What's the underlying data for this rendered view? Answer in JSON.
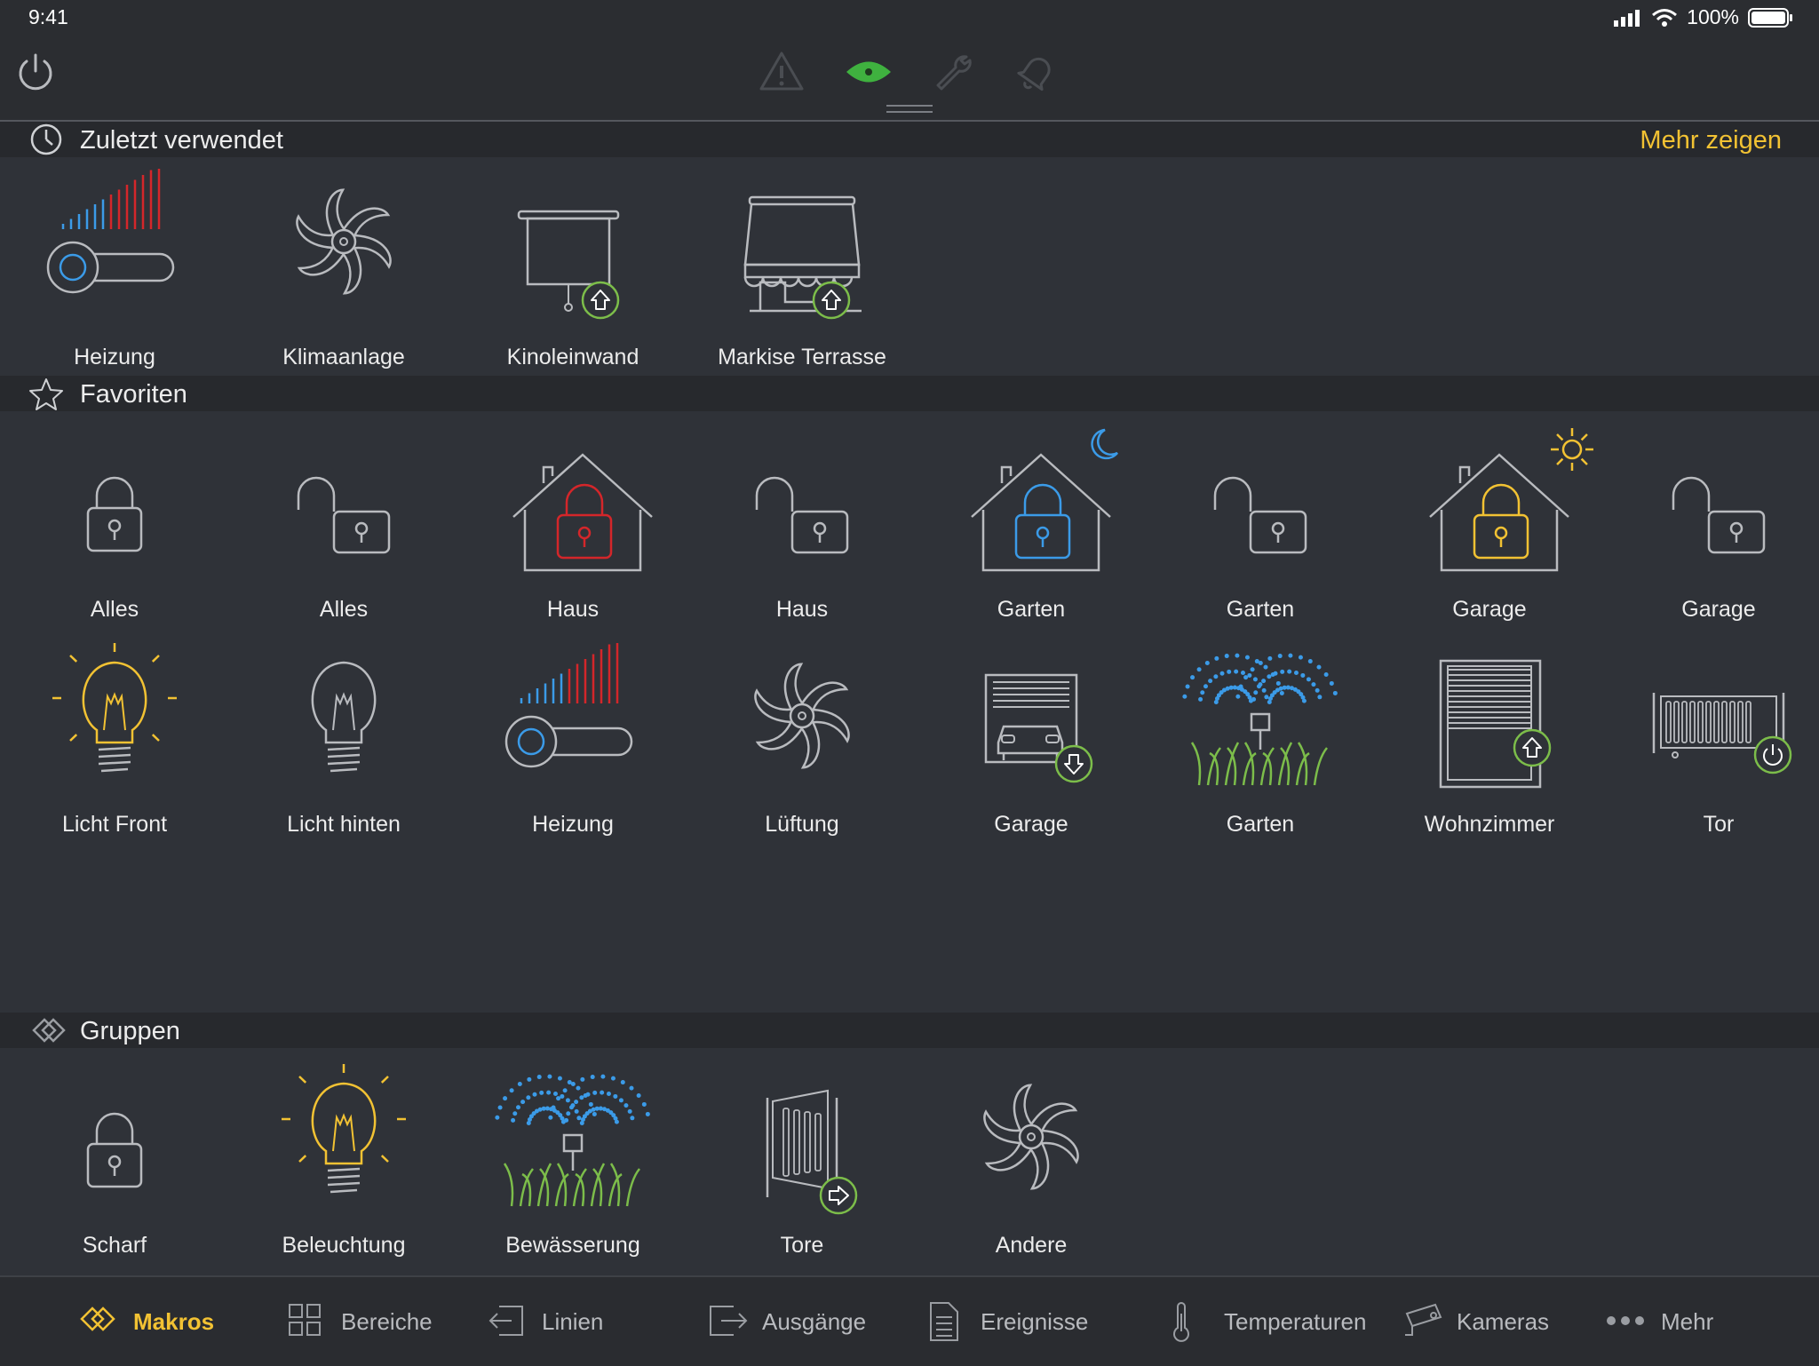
{
  "status": {
    "time": "9:41",
    "battery": "100%"
  },
  "topbar": {
    "icons": [
      "power-icon",
      "warning-icon",
      "eye-icon",
      "wrench-icon",
      "bell-icon"
    ],
    "active_color": "#3fb13f"
  },
  "recent": {
    "title": "Zuletzt verwendet",
    "more": "Mehr zeigen",
    "items": [
      {
        "label": "Heizung",
        "icon": "heating-slider-icon"
      },
      {
        "label": "Klimaanlage",
        "icon": "fan-icon"
      },
      {
        "label": "Kinoleinwand",
        "icon": "projector-screen-icon"
      },
      {
        "label": "Markise Terrasse",
        "icon": "awning-icon"
      }
    ]
  },
  "favorites": {
    "title": "Favoriten",
    "items": [
      {
        "label": "Alles",
        "icon": "lock-closed-icon"
      },
      {
        "label": "Alles",
        "icon": "lock-open-icon"
      },
      {
        "label": "Haus",
        "icon": "house-lock-red-icon"
      },
      {
        "label": "Haus",
        "icon": "lock-open-icon"
      },
      {
        "label": "Garten",
        "icon": "house-lock-night-icon"
      },
      {
        "label": "Garten",
        "icon": "lock-open-icon"
      },
      {
        "label": "Garage",
        "icon": "house-lock-day-icon"
      },
      {
        "label": "Garage",
        "icon": "lock-open-icon"
      },
      {
        "label": "Licht Front",
        "icon": "bulb-on-icon"
      },
      {
        "label": "Licht hinten",
        "icon": "bulb-off-icon"
      },
      {
        "label": "Heizung",
        "icon": "heating-slider-icon"
      },
      {
        "label": "Lüftung",
        "icon": "fan-icon"
      },
      {
        "label": "Garage",
        "icon": "garage-door-icon"
      },
      {
        "label": "Garten",
        "icon": "sprinkler-icon"
      },
      {
        "label": "Wohnzimmer",
        "icon": "shutter-icon"
      },
      {
        "label": "Tor",
        "icon": "gate-icon"
      }
    ]
  },
  "groups": {
    "title": "Gruppen",
    "items": [
      {
        "label": "Scharf",
        "icon": "lock-closed-icon"
      },
      {
        "label": "Beleuchtung",
        "icon": "bulb-on-icon"
      },
      {
        "label": "Bewässerung",
        "icon": "sprinkler-icon"
      },
      {
        "label": "Tore",
        "icon": "swing-gate-icon"
      },
      {
        "label": "Andere",
        "icon": "fan-icon"
      }
    ]
  },
  "tabs": [
    {
      "label": "Makros",
      "icon": "macros-icon",
      "active": true
    },
    {
      "label": "Bereiche",
      "icon": "grid-icon",
      "active": false
    },
    {
      "label": "Linien",
      "icon": "enter-icon",
      "active": false
    },
    {
      "label": "Ausgänge",
      "icon": "exit-icon",
      "active": false
    },
    {
      "label": "Ereignisse",
      "icon": "document-icon",
      "active": false
    },
    {
      "label": "Temperaturen",
      "icon": "thermometer-icon",
      "active": false
    },
    {
      "label": "Kameras",
      "icon": "camera-icon",
      "active": false
    },
    {
      "label": "Mehr",
      "icon": "more-icon",
      "active": false
    }
  ],
  "colors": {
    "accent": "#f2c233",
    "background": "#2f3238",
    "header": "#27292d",
    "red": "#d4262a",
    "blue": "#3b9be8",
    "green": "#7cbd4a",
    "yellow": "#f2c233"
  }
}
